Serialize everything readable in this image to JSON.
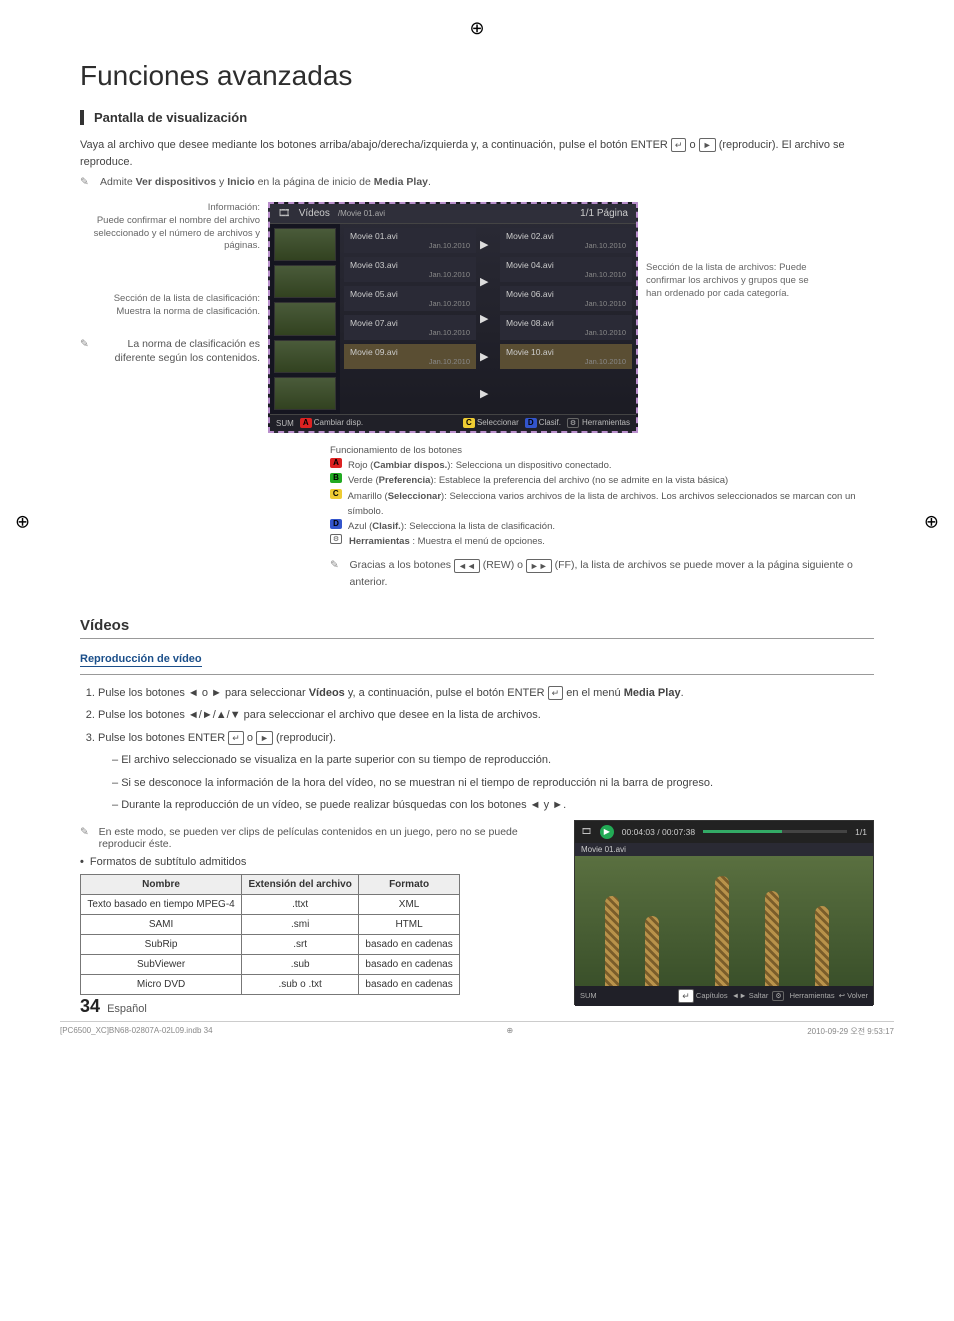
{
  "title": "Funciones avanzadas",
  "section1_heading": "Pantalla de visualización",
  "intro_text": "Vaya al archivo que desee mediante los botones arriba/abajo/derecha/izquierda y, a continuación, pulse el botón ENTER",
  "intro_text2": "(reproducir). El archivo se reproduce.",
  "or_word": "o",
  "admite_line_pre": "Admite ",
  "admite_bold1": "Ver dispositivos",
  "admite_mid": " y ",
  "admite_bold2": "Inicio",
  "admite_post": " en la página de inicio de ",
  "admite_bold3": "Media Play",
  "left_info_title": "Información:",
  "left_info_body": "Puede confirmar el nombre del archivo seleccionado y el número de archivos y páginas.",
  "left_clasif_title": "Sección de la lista de clasificación:",
  "left_clasif_body": "Muestra la norma de clasificación.",
  "left_norma": "La norma de clasificación es diferente según los contenidos.",
  "right_label": "Sección de la lista de archivos: Puede confirmar los archivos y grupos que se han ordenado por cada categoría.",
  "screen": {
    "title_left": "Vídeos",
    "breadcrumb": "/Movie 01.avi",
    "page": "1/1 Página",
    "files": [
      {
        "name": "Movie 01.avi",
        "date": "Jan.10.2010"
      },
      {
        "name": "Movie 02.avi",
        "date": "Jan.10.2010"
      },
      {
        "name": "Movie 03.avi",
        "date": "Jan.10.2010"
      },
      {
        "name": "Movie 04.avi",
        "date": "Jan.10.2010"
      },
      {
        "name": "Movie 05.avi",
        "date": "Jan.10.2010"
      },
      {
        "name": "Movie 06.avi",
        "date": "Jan.10.2010"
      },
      {
        "name": "Movie 07.avi",
        "date": "Jan.10.2010"
      },
      {
        "name": "Movie 08.avi",
        "date": "Jan.10.2010"
      },
      {
        "name": "Movie 09.avi",
        "date": "Jan.10.2010"
      },
      {
        "name": "Movie 10.avi",
        "date": "Jan.10.2010"
      }
    ],
    "footer_sum": "SUM",
    "footer_a": "Cambiar disp.",
    "footer_c": "Seleccionar",
    "footer_d": "Clasif.",
    "footer_tools": "Herramientas"
  },
  "func_heading": "Funcionamiento de los botones",
  "func_a_pre": "Rojo (",
  "func_a_b": "Cambiar dispos.",
  "func_a_post": "): Selecciona un dispositivo conectado.",
  "func_b_pre": "Verde (",
  "func_b_b": "Preferencia",
  "func_b_post": "): Establece la preferencia del archivo (no se admite en la vista básica)",
  "func_c_pre": "Amarillo (",
  "func_c_b": "Seleccionar",
  "func_c_post": "): Selecciona varios archivos de la lista de archivos. Los archivos seleccionados se marcan con un símbolo.",
  "func_d_pre": "Azul (",
  "func_d_b": "Clasif.",
  "func_d_post": "): Selecciona la lista de clasificación.",
  "func_t_b": "Herramientas",
  "func_t_post": " : Muestra el menú de opciones.",
  "func_note": "Gracias a los botones ",
  "func_note_mid": " (REW) o ",
  "func_note_end": " (FF), la lista de archivos se puede mover a la página siguiente o anterior.",
  "videos_heading": "Vídeos",
  "repro_heading": "Reproducción de vídeo",
  "step1_pre": "Pulse los botones ◄ o ► para seleccionar ",
  "step1_b1": "Vídeos",
  "step1_mid": " y, a continuación, pulse el botón ENTER",
  "step1_post": " en el menú ",
  "step1_b2": "Media Play",
  "step2": "Pulse los botones ◄/►/▲/▼ para seleccionar el archivo que desee en la lista de archivos.",
  "step3_pre": "Pulse los botones ENTER",
  "step3_mid": " o ",
  "step3_post": " (reproducir).",
  "step3_d1": "El archivo seleccionado se visualiza en la parte superior con su tiempo de reproducción.",
  "step3_d2": "Si se desconoce la información de la hora del vídeo, no se muestran ni el tiempo de reproducción ni la barra de progreso.",
  "step3_d3": "Durante la reproducción de un vídeo, se puede realizar búsquedas con los botones ◄ y ►.",
  "note_clips": "En este modo, se pueden ver clips de películas contenidos en un juego, pero no se puede reproducir éste.",
  "formatos_bullet": "Formatos de subtítulo admitidos",
  "table": {
    "h1": "Nombre",
    "h2": "Extensión del archivo",
    "h3": "Formato",
    "rows": [
      {
        "c1": "Texto basado en tiempo MPEG-4",
        "c2": ".ttxt",
        "c3": "XML"
      },
      {
        "c1": "SAMI",
        "c2": ".smi",
        "c3": "HTML"
      },
      {
        "c1": "SubRip",
        "c2": ".srt",
        "c3": "basado en cadenas"
      },
      {
        "c1": "SubViewer",
        "c2": ".sub",
        "c3": "basado en cadenas"
      },
      {
        "c1": "Micro DVD",
        "c2": ".sub o .txt",
        "c3": "basado en cadenas"
      }
    ]
  },
  "player": {
    "time": "00:04:03 / 00:07:38",
    "count": "1/1",
    "file": "Movie 01.avi",
    "sum": "SUM",
    "capitulos": "Capítulos",
    "saltar": "Saltar",
    "herramientas": "Herramientas",
    "volver": "Volver"
  },
  "page_number": "34",
  "page_lang": "Español",
  "foot_left": "[PC6500_XC]BN68-02807A-02L09.indb   34",
  "foot_right": "2010-09-29   오전 9:53:17"
}
